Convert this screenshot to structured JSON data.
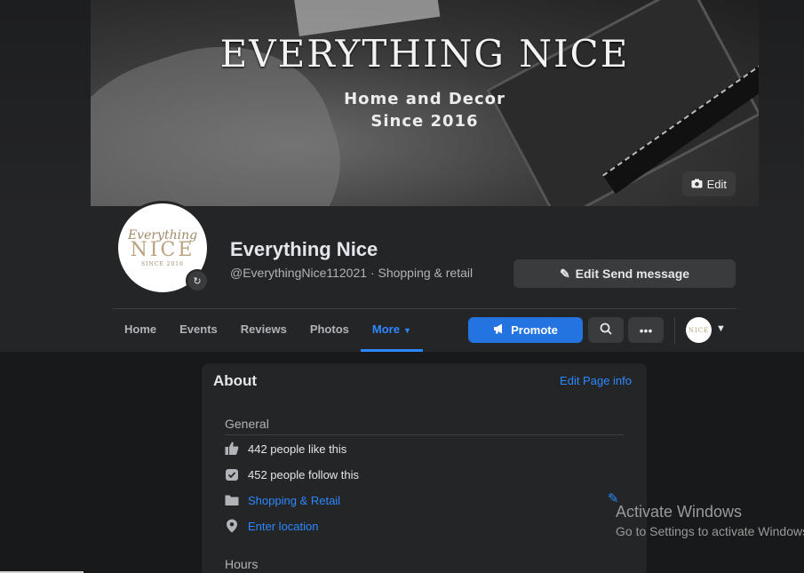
{
  "cover": {
    "title": "EVERYTHING NICE",
    "subtitle_1": "Home and Decor",
    "subtitle_2": "Since 2016",
    "edit_label": "Edit"
  },
  "avatar": {
    "line1": "Everything",
    "line2": "NICE",
    "line3": "SINCE 2016"
  },
  "profile": {
    "name": "Everything Nice",
    "handle_category": "@EverythingNice112021 · Shopping & retail",
    "edit_send_label": "Edit Send message"
  },
  "nav": {
    "tabs": [
      "Home",
      "Events",
      "Reviews",
      "Photos",
      "More"
    ],
    "active": "More",
    "promote_label": "Promote",
    "mini_avatar_text": "NICE"
  },
  "about": {
    "title": "About",
    "edit_link": "Edit Page info",
    "general_title": "General",
    "likes": "442 people like this",
    "follows": "452 people follow this",
    "category": "Shopping & Retail",
    "location": "Enter location",
    "hours_title": "Hours"
  },
  "watermark": {
    "line1": "Activate Windows",
    "line2": "Go to Settings to activate Windows."
  },
  "colors": {
    "accent": "#2d88ff",
    "promote": "#2374e1",
    "card_bg": "#242526",
    "page_bg": "#18191a"
  }
}
